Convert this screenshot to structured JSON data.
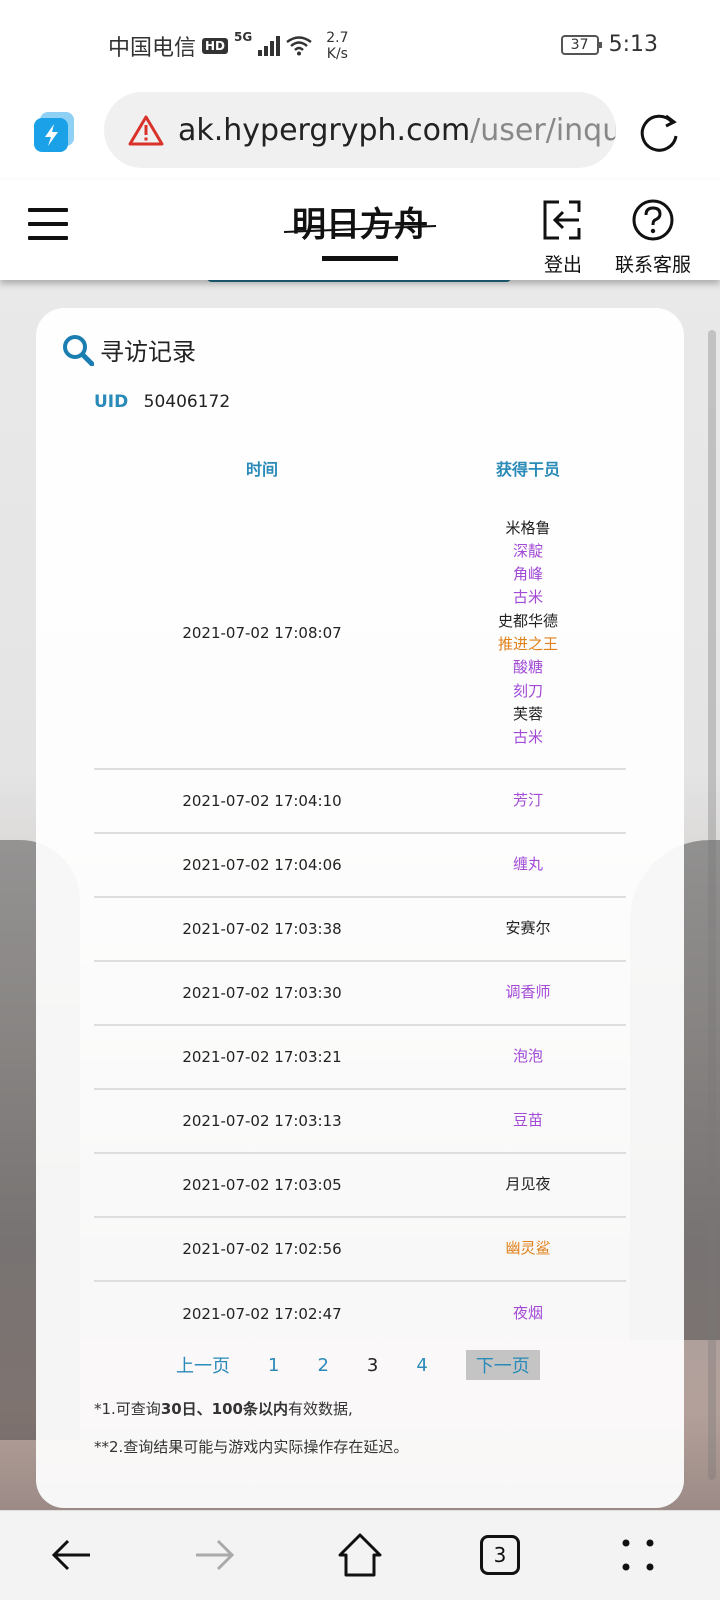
{
  "status_bar": {
    "carrier": "中国电信",
    "hd_badge": "HD",
    "network": "5G",
    "speed_value": "2.7",
    "speed_unit": "K/s",
    "battery": "37",
    "time": "5:13"
  },
  "browser": {
    "url_domain": "ak.hypergryph.com",
    "url_path": "/user/inqui",
    "tab_count": "3"
  },
  "header": {
    "logo_text": "明日方舟",
    "logout_label": "登出",
    "support_label": "联系客服"
  },
  "card": {
    "title": "寻访记录",
    "uid_label": "UID",
    "uid_value": "50406172",
    "columns": {
      "time": "时间",
      "operator": "获得干员"
    },
    "rows": [
      {
        "time": "2021-07-02 17:08:07",
        "operators": [
          {
            "name": "米格鲁",
            "rarity_color": "#222222"
          },
          {
            "name": "深靛",
            "rarity_color": "#a24ad6"
          },
          {
            "name": "角峰",
            "rarity_color": "#a24ad6"
          },
          {
            "name": "古米",
            "rarity_color": "#a24ad6"
          },
          {
            "name": "史都华德",
            "rarity_color": "#222222"
          },
          {
            "name": "推进之王",
            "rarity_color": "#e0801a"
          },
          {
            "name": "酸糖",
            "rarity_color": "#a24ad6"
          },
          {
            "name": "刻刀",
            "rarity_color": "#a24ad6"
          },
          {
            "name": "芙蓉",
            "rarity_color": "#222222"
          },
          {
            "name": "古米",
            "rarity_color": "#a24ad6"
          }
        ]
      },
      {
        "time": "2021-07-02 17:04:10",
        "operators": [
          {
            "name": "芳汀",
            "rarity_color": "#a24ad6"
          }
        ]
      },
      {
        "time": "2021-07-02 17:04:06",
        "operators": [
          {
            "name": "缠丸",
            "rarity_color": "#a24ad6"
          }
        ]
      },
      {
        "time": "2021-07-02 17:03:38",
        "operators": [
          {
            "name": "安赛尔",
            "rarity_color": "#222222"
          }
        ]
      },
      {
        "time": "2021-07-02 17:03:30",
        "operators": [
          {
            "name": "调香师",
            "rarity_color": "#a24ad6"
          }
        ]
      },
      {
        "time": "2021-07-02 17:03:21",
        "operators": [
          {
            "name": "泡泡",
            "rarity_color": "#a24ad6"
          }
        ]
      },
      {
        "time": "2021-07-02 17:03:13",
        "operators": [
          {
            "name": "豆苗",
            "rarity_color": "#a24ad6"
          }
        ]
      },
      {
        "time": "2021-07-02 17:03:05",
        "operators": [
          {
            "name": "月见夜",
            "rarity_color": "#222222"
          }
        ]
      },
      {
        "time": "2021-07-02 17:02:56",
        "operators": [
          {
            "name": "幽灵鲨",
            "rarity_color": "#e0801a"
          }
        ]
      },
      {
        "time": "2021-07-02 17:02:47",
        "operators": [
          {
            "name": "夜烟",
            "rarity_color": "#a24ad6"
          }
        ]
      }
    ],
    "pagination": {
      "prev": "上一页",
      "pages": [
        "1",
        "2",
        "3",
        "4"
      ],
      "current_page": "3",
      "next": "下一页"
    },
    "notes": {
      "note1_prefix": "*1.可查询",
      "note1_bold": "30日、100条以内",
      "note1_suffix": "有效数据,",
      "note2": "**2.查询结果可能与游戏内实际操作存在延迟。"
    }
  },
  "colors": {
    "accent": "#2a8ab8",
    "header_strip": "#206c86",
    "rarity_4": "#a24ad6",
    "rarity_5": "#e0801a",
    "rarity_3": "#222222"
  }
}
